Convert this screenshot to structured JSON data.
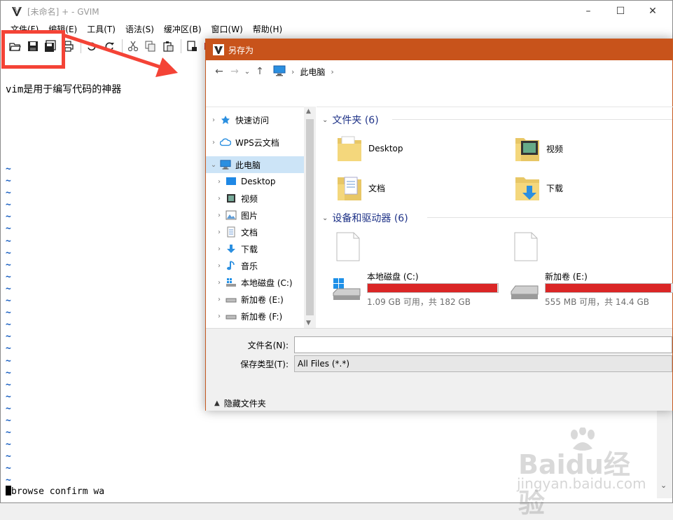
{
  "gvim": {
    "title": "[未命名] + - GVIM",
    "menu": [
      "文件(F)",
      "编辑(E)",
      "工具(T)",
      "语法(S)",
      "缓冲区(B)",
      "窗口(W)",
      "帮助(H)"
    ],
    "editor_text": "vim是用于编写代码的神器",
    "tilde_count": 27,
    "command_line": "browse confirm wa"
  },
  "dialog": {
    "title": "另存为",
    "breadcrumb": [
      "此电脑"
    ],
    "tree": [
      {
        "label": "快速访问",
        "icon": "star-icon",
        "indent": 0
      },
      {
        "label": "WPS云文档",
        "icon": "cloud-icon",
        "indent": 0
      },
      {
        "label": "此电脑",
        "icon": "computer-icon",
        "indent": 0,
        "selected": true
      },
      {
        "label": "Desktop",
        "icon": "desktop-icon",
        "indent": 1
      },
      {
        "label": "视频",
        "icon": "video-icon",
        "indent": 1
      },
      {
        "label": "图片",
        "icon": "picture-icon",
        "indent": 1
      },
      {
        "label": "文档",
        "icon": "document-icon",
        "indent": 1
      },
      {
        "label": "下载",
        "icon": "download-icon",
        "indent": 1
      },
      {
        "label": "音乐",
        "icon": "music-icon",
        "indent": 1
      },
      {
        "label": "本地磁盘 (C:)",
        "icon": "windows-drive-icon",
        "indent": 1
      },
      {
        "label": "新加卷 (E:)",
        "icon": "drive-icon",
        "indent": 1
      },
      {
        "label": "新加卷 (F:)",
        "icon": "drive-icon",
        "indent": 1
      }
    ],
    "folders_header": "文件夹 (6)",
    "folders": [
      {
        "label": "Desktop",
        "icon": "desktop-folder-icon"
      },
      {
        "label": "视频",
        "icon": "video-folder-icon"
      },
      {
        "label": "文档",
        "icon": "documents-folder-icon"
      },
      {
        "label": "下载",
        "icon": "downloads-folder-icon"
      }
    ],
    "devices_header": "设备和驱动器 (6)",
    "drives": [
      {
        "name": "本地磁盘 (C:)",
        "info": "1.09 GB 可用，共 182 GB",
        "used_fraction": 0.994
      },
      {
        "name": "新加卷 (E:)",
        "info": "555 MB 可用，共 14.4 GB",
        "used_fraction": 0.962
      }
    ],
    "filename_label": "文件名(N):",
    "filename_value": "",
    "filetype_label": "保存类型(T):",
    "filetype_value": "All Files (*.*)",
    "hide_folders": "隐藏文件夹"
  },
  "watermark": {
    "brand": "Baidu经验",
    "url": "jingyan.baidu.com"
  },
  "colors": {
    "dialog_title": "#c8531b",
    "highlight": "#f44336",
    "tilde": "#1a5fc0",
    "drive_bar": "#da2626",
    "group_header": "#1e3287"
  }
}
